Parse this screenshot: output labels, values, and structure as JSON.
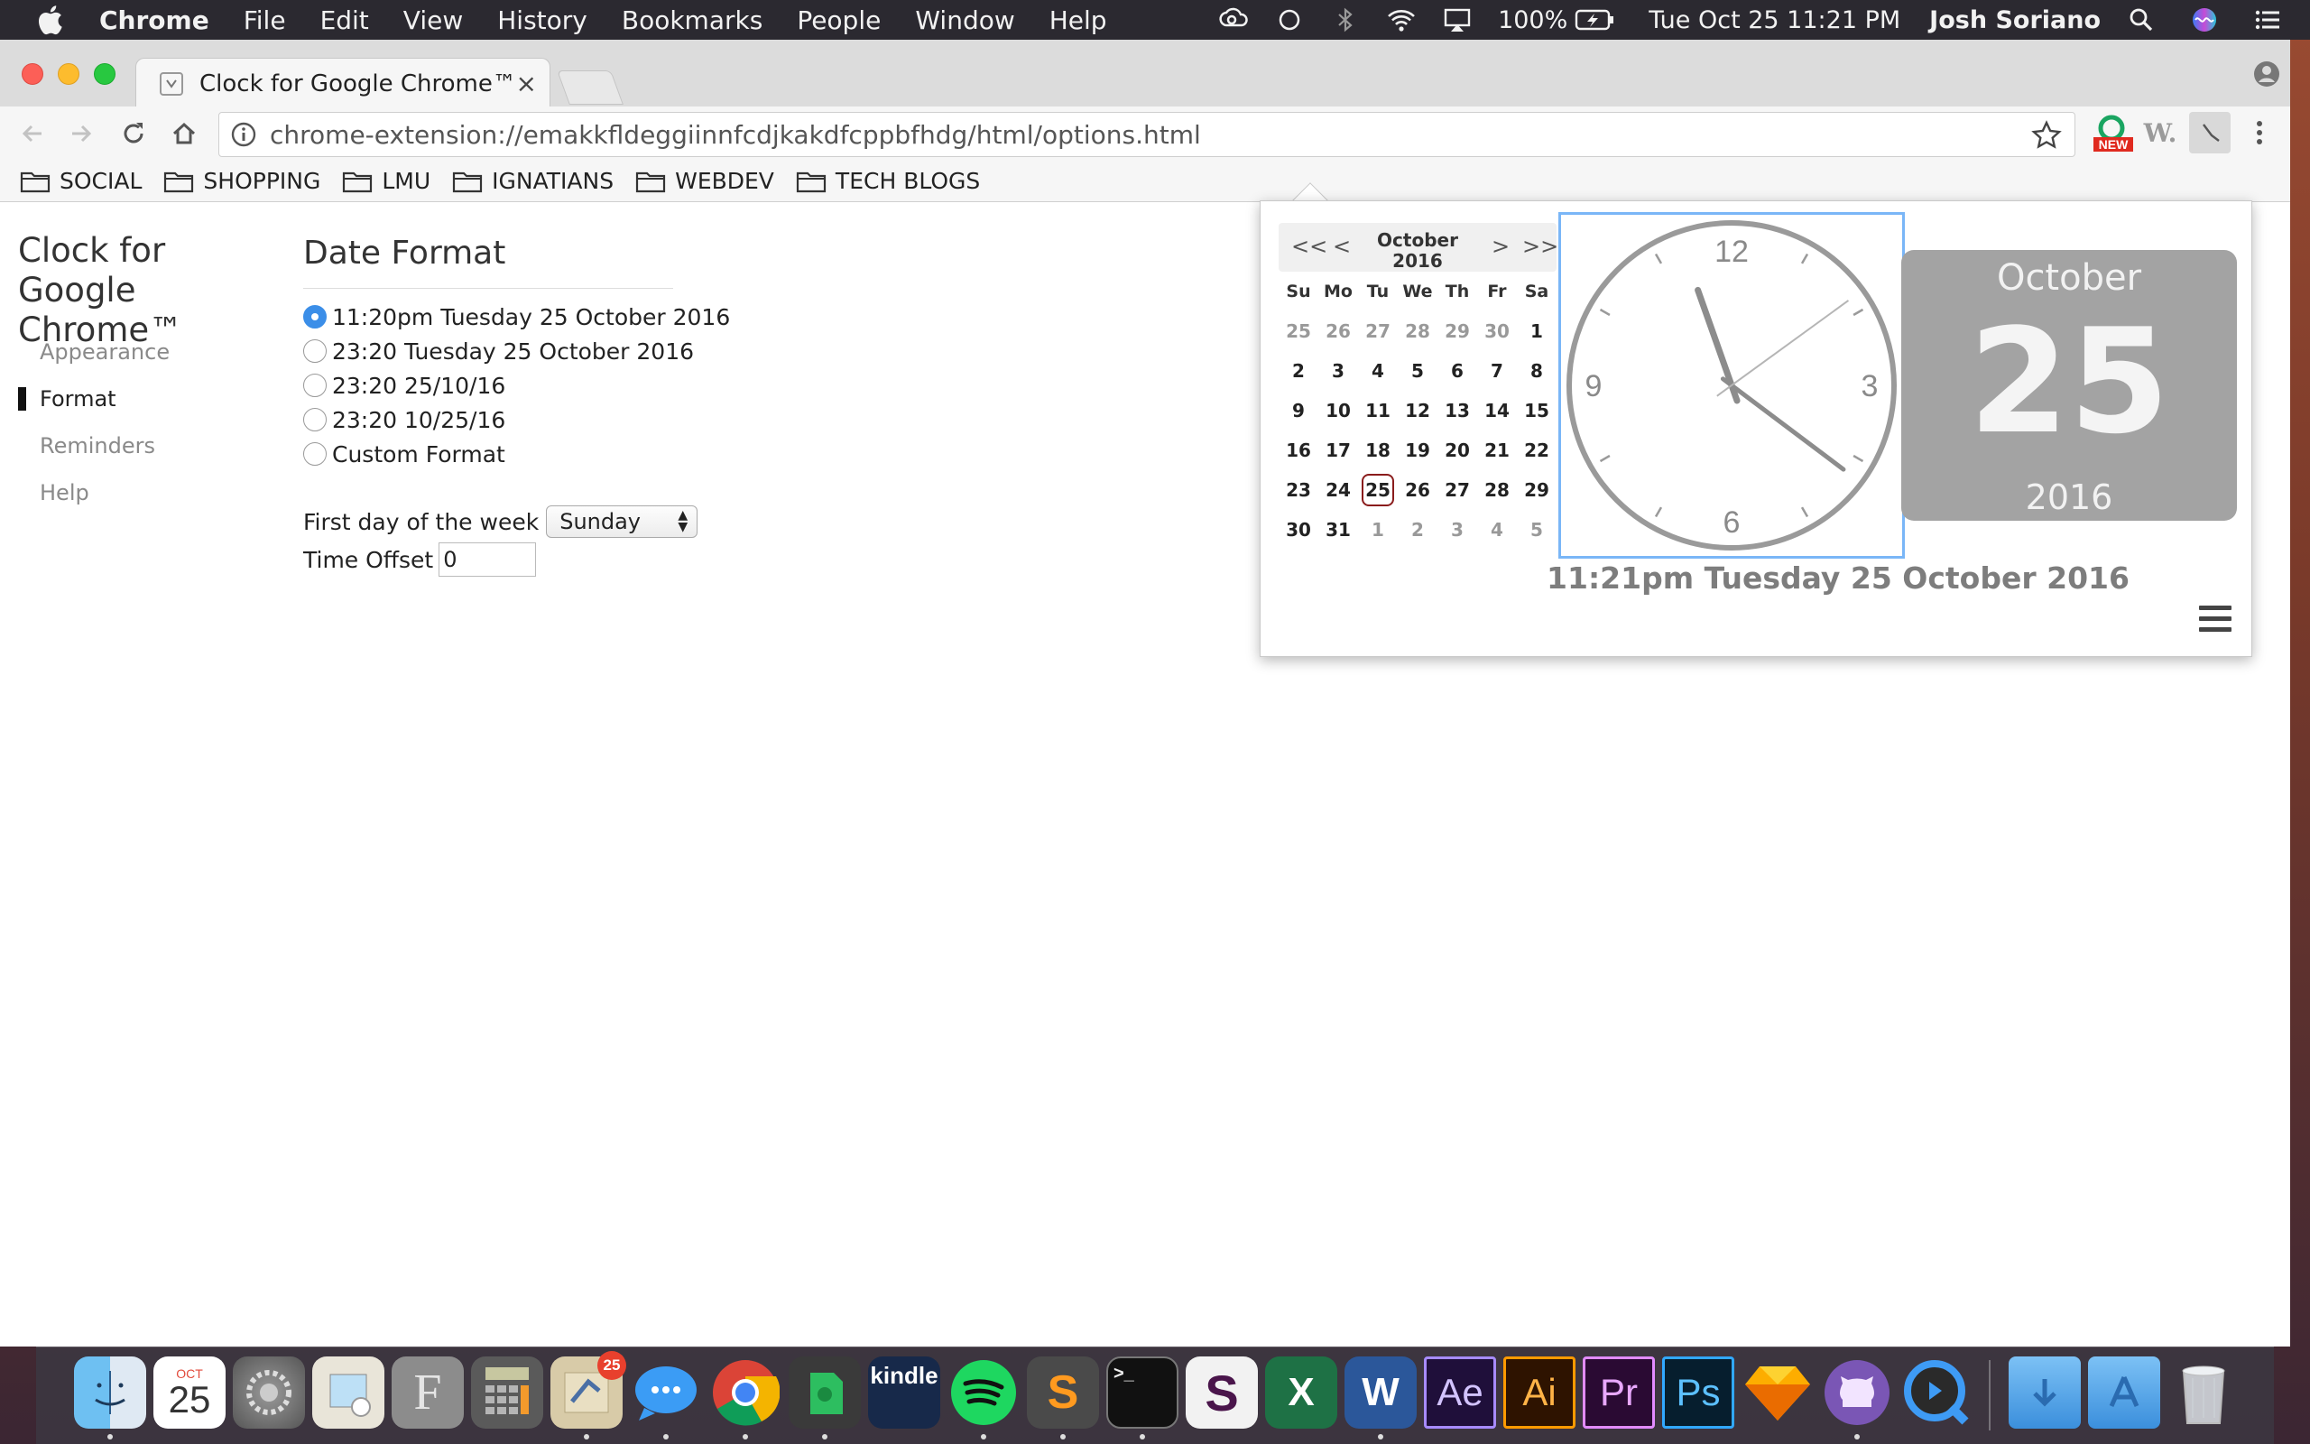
{
  "menubar": {
    "app_name": "Chrome",
    "menus": [
      "File",
      "Edit",
      "View",
      "History",
      "Bookmarks",
      "People",
      "Window",
      "Help"
    ],
    "battery": "100%",
    "clock": "Tue Oct 25  11:21 PM",
    "user": "Josh Soriano"
  },
  "browser": {
    "tab_title": "Clock for Google Chrome™",
    "tab_close": "×",
    "url": "chrome-extension://emakkfldeggiinnfcdjkakdfcppbfhdg/html/options.html",
    "new_badge": "NEW",
    "ext_w": "W.",
    "bookmarks": [
      "SOCIAL",
      "SHOPPING",
      "LMU",
      "IGNATIANS",
      "WEBDEV",
      "TECH BLOGS"
    ]
  },
  "sidebar": {
    "title": "Clock for Google Chrome™",
    "items": [
      {
        "label": "Appearance",
        "active": false
      },
      {
        "label": "Format",
        "active": true
      },
      {
        "label": "Reminders",
        "active": false
      },
      {
        "label": "Help",
        "active": false
      }
    ]
  },
  "content": {
    "heading": "Date Format",
    "options": [
      {
        "label": "11:20pm Tuesday 25 October 2016",
        "checked": true
      },
      {
        "label": "23:20 Tuesday 25 October 2016",
        "checked": false
      },
      {
        "label": "23:20 25/10/16",
        "checked": false
      },
      {
        "label": "23:20 10/25/16",
        "checked": false
      },
      {
        "label": "Custom Format",
        "checked": false
      }
    ],
    "first_day_label": "First day of the week",
    "first_day_value": "Sunday",
    "time_offset_label": "Time Offset",
    "time_offset_value": "0"
  },
  "popup": {
    "calendar": {
      "month": "October",
      "year": "2016",
      "nav": {
        "prev_year": "<<",
        "prev": "<",
        "next": ">",
        "next_year": ">>"
      },
      "weekdays": [
        "Su",
        "Mo",
        "Tu",
        "We",
        "Th",
        "Fr",
        "Sa"
      ],
      "weeks": [
        [
          "25",
          "26",
          "27",
          "28",
          "29",
          "30",
          "1"
        ],
        [
          "2",
          "3",
          "4",
          "5",
          "6",
          "7",
          "8"
        ],
        [
          "9",
          "10",
          "11",
          "12",
          "13",
          "14",
          "15"
        ],
        [
          "16",
          "17",
          "18",
          "19",
          "20",
          "21",
          "22"
        ],
        [
          "23",
          "24",
          "25",
          "26",
          "27",
          "28",
          "29"
        ],
        [
          "30",
          "31",
          "1",
          "2",
          "3",
          "4",
          "5"
        ]
      ],
      "muted_cells": [
        [
          0,
          0
        ],
        [
          0,
          1
        ],
        [
          0,
          2
        ],
        [
          0,
          3
        ],
        [
          0,
          4
        ],
        [
          0,
          5
        ],
        [
          5,
          2
        ],
        [
          5,
          3
        ],
        [
          5,
          4
        ],
        [
          5,
          5
        ],
        [
          5,
          6
        ]
      ],
      "today_cell": [
        4,
        2
      ]
    },
    "clock": {
      "numerals": {
        "top": "12",
        "right": "3",
        "bottom": "6",
        "left": "9"
      },
      "time": {
        "hour": 11,
        "minute": 21,
        "second": 9
      }
    },
    "date_card": {
      "month": "October",
      "day": "25",
      "year": "2016"
    },
    "time_text": "11:21pm Tuesday 25 October 2016"
  },
  "dock": {
    "calendar_month": "OCT",
    "calendar_day": "25",
    "mail_badge": "25",
    "apps": [
      "Finder",
      "Calendar",
      "System Preferences",
      "Preview",
      "Font Book",
      "Calculator",
      "Mail",
      "Messages",
      "Chrome",
      "Evernote",
      "Kindle",
      "Spotify",
      "Sublime Text",
      "Terminal",
      "Slack",
      "Excel",
      "Word",
      "After Effects",
      "Illustrator",
      "Premiere Pro",
      "Photoshop",
      "Sketch",
      "GitHub",
      "QuickTime",
      "Downloads",
      "Applications",
      "Trash"
    ],
    "labels": {
      "kindle": "kindle",
      "excel": "X",
      "word": "W",
      "ae": "Ae",
      "ai": "Ai",
      "pr": "Pr",
      "ps": "Ps",
      "sublime": "S",
      "slack": "S",
      "terminal": ">_",
      "fontbook": "F"
    }
  },
  "colors": {
    "accent_blue": "#3b8ee8",
    "date_card_bg": "#a3a3a3",
    "today_ring": "#8a1c1c"
  }
}
